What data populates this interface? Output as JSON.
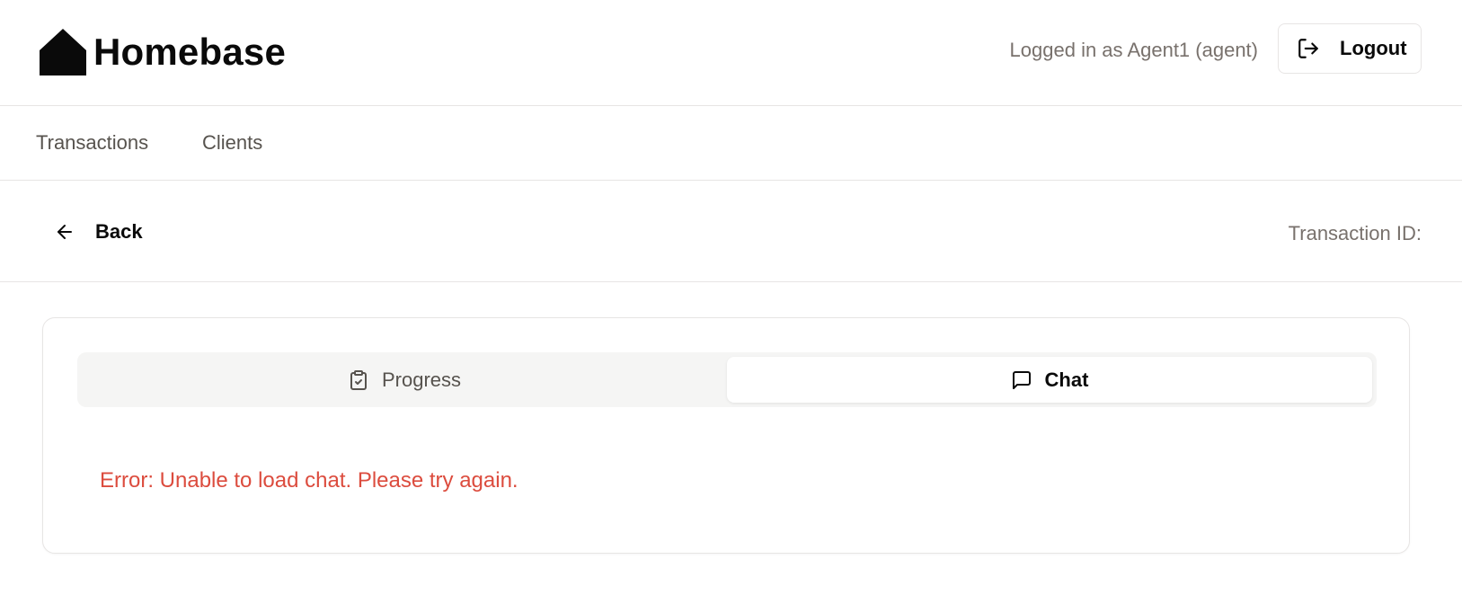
{
  "header": {
    "app_name": "Homebase",
    "logged_in_text": "Logged in as Agent1 (agent)",
    "logout_label": "Logout"
  },
  "nav": {
    "items": [
      {
        "label": "Transactions"
      },
      {
        "label": "Clients"
      }
    ]
  },
  "subbar": {
    "back_label": "Back",
    "transaction_id_label": "Transaction ID:"
  },
  "tabs": [
    {
      "label": "Progress",
      "icon": "clipboard-check-icon",
      "active": false
    },
    {
      "label": "Chat",
      "icon": "message-square-icon",
      "active": true
    }
  ],
  "chat": {
    "error_message": "Error: Unable to load chat. Please try again."
  },
  "colors": {
    "error": "#dc4c3e",
    "muted_text": "#78716c",
    "border": "#e7e5e4",
    "tab_track": "#f5f5f4"
  }
}
